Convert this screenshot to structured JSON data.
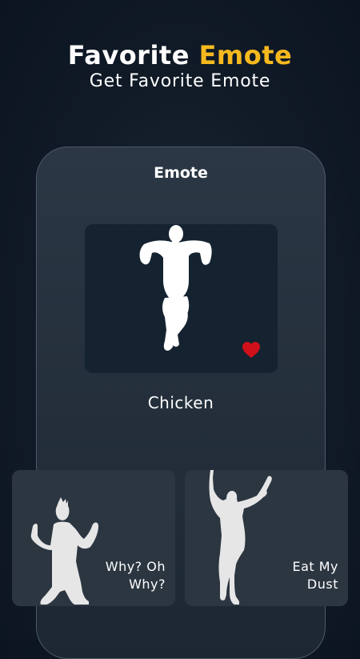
{
  "header": {
    "title_part1": "Favorite",
    "title_part2": "Emote",
    "subtitle": "Get Favorite Emote"
  },
  "phone": {
    "title": "Emote",
    "selected": {
      "name": "Chicken",
      "favorite_icon": "heart-icon",
      "favorite_color": "#d0111a"
    }
  },
  "cards": [
    {
      "label": "Why? Oh\nWhy?"
    },
    {
      "label": "Eat My\nDust"
    }
  ],
  "colors": {
    "accent": "#f6b91e",
    "background": "#0f1925",
    "card": "#2c3641"
  }
}
